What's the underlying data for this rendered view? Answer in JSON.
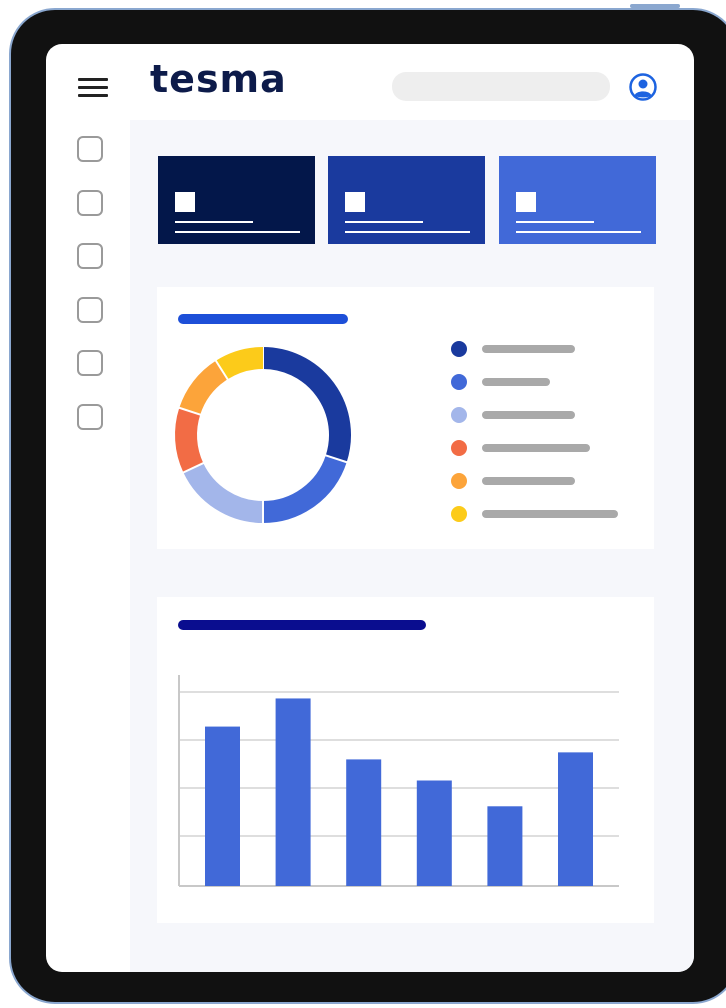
{
  "app": {
    "logo_text": "tesma"
  },
  "header": {
    "menu_icon": "hamburger-menu-icon",
    "search_placeholder": "",
    "user_icon": "user-account-icon"
  },
  "colors": {
    "navy": "#03174a",
    "royal": "#1a3a9e",
    "blue": "#4169d8",
    "panel_bg": "#f6f7fb",
    "chart_title_1": "#1d4fd8",
    "chart_title_2": "#0a0d8f"
  },
  "sidebar": {
    "items": [
      {
        "icon": "checkbox-icon"
      },
      {
        "icon": "checkbox-icon"
      },
      {
        "icon": "checkbox-icon"
      },
      {
        "icon": "checkbox-icon"
      },
      {
        "icon": "checkbox-icon"
      },
      {
        "icon": "checkbox-icon"
      }
    ]
  },
  "stat_cards": [
    {
      "color": "#03174a"
    },
    {
      "color": "#1a3a9e"
    },
    {
      "color": "#4169d8"
    }
  ],
  "chart_data": [
    {
      "type": "pie",
      "variant": "donut",
      "values": [
        30,
        20,
        18,
        12,
        11,
        9
      ],
      "colors": [
        "#1a3a9e",
        "#4169d8",
        "#a3b6ea",
        "#f26c45",
        "#fca43a",
        "#fccb1a"
      ],
      "legend_placement": "right",
      "title": ""
    },
    {
      "type": "bar",
      "values": [
        68,
        80,
        54,
        45,
        34,
        57
      ],
      "color": "#4169d8",
      "ylim": [
        0,
        90
      ],
      "grid": true,
      "title": ""
    }
  ]
}
